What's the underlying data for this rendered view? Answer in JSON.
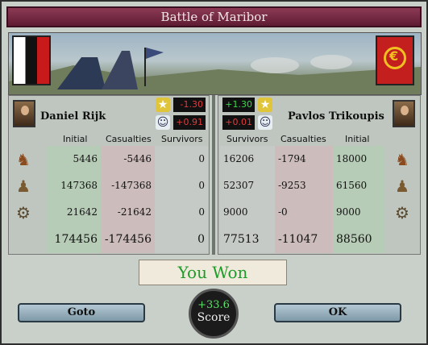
{
  "title": "Battle of Maribor",
  "left": {
    "commander": "Daniel Rijk",
    "mods": [
      {
        "icon": "star-icon",
        "value": "-1.30"
      },
      {
        "icon": "officer-icon",
        "value": "+0.91"
      }
    ],
    "headers": {
      "initial": "Initial",
      "casualties": "Casualties",
      "survivors": "Survivors"
    },
    "rows": [
      {
        "type": "cavalry",
        "initial": "5446",
        "casualties": "-5446",
        "survivors": "0"
      },
      {
        "type": "infantry",
        "initial": "147368",
        "casualties": "-147368",
        "survivors": "0"
      },
      {
        "type": "artillery",
        "initial": "21642",
        "casualties": "-21642",
        "survivors": "0"
      }
    ],
    "totals": {
      "initial": "174456",
      "casualties": "-174456",
      "survivors": "0"
    }
  },
  "right": {
    "commander": "Pavlos Trikoupis",
    "mods": [
      {
        "icon": "star-icon",
        "value": "+1.30"
      },
      {
        "icon": "officer-icon",
        "value": "+0.01"
      }
    ],
    "headers": {
      "survivors": "Survivors",
      "casualties": "Casualties",
      "initial": "Initial"
    },
    "rows": [
      {
        "type": "cavalry",
        "survivors": "16206",
        "casualties": "-1794",
        "initial": "18000"
      },
      {
        "type": "infantry",
        "survivors": "52307",
        "casualties": "-9253",
        "initial": "61560"
      },
      {
        "type": "artillery",
        "survivors": "9000",
        "casualties": "-0",
        "initial": "9000"
      }
    ],
    "totals": {
      "survivors": "77513",
      "casualties": "-11047",
      "initial": "88560"
    }
  },
  "result": "You Won",
  "score": {
    "value": "+33.6",
    "label": "Score"
  },
  "buttons": {
    "goto": "Goto",
    "ok": "OK"
  },
  "colors": {
    "won": "#1f9b2a",
    "negative": "#e23b3b",
    "positive": "#39d64a"
  }
}
